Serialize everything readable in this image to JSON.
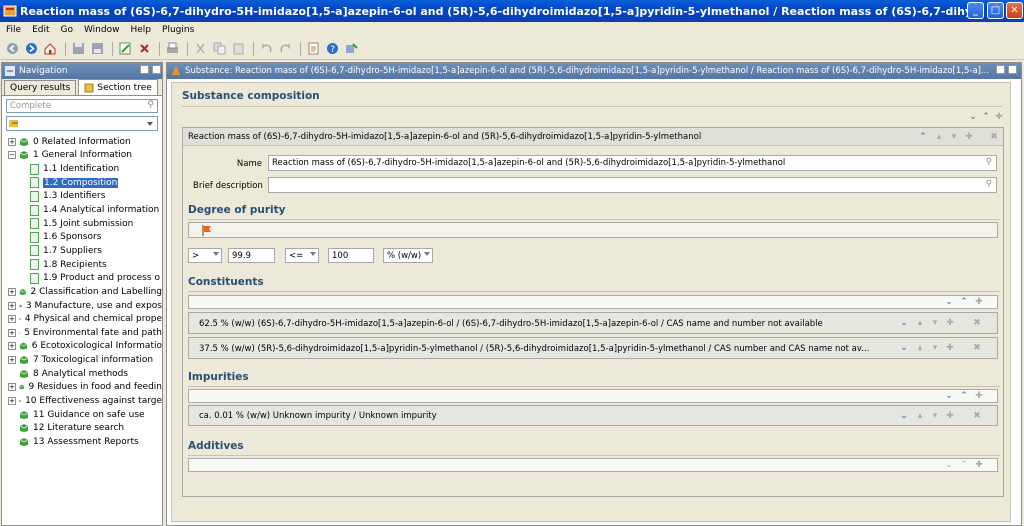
{
  "window": {
    "title": "Reaction mass of (6S)-6,7-dihydro-5H-imidazo[1,5-a]azepin-6-ol and (5R)-5,6-dihydroimidazo[1,5-a]pyridin-5-ylmethanol / Reaction mass of (6S)-6,7-dihydro-5H-imidazo[1,5-a]azepin-6-..."
  },
  "menu": [
    "File",
    "Edit",
    "Go",
    "Window",
    "Help",
    "Plugins"
  ],
  "navigation": {
    "title": "Navigation",
    "tabs": [
      "Query results",
      "Section tree"
    ],
    "search_placeholder": "Complete",
    "tree": [
      {
        "label": "0 Related Information",
        "level": 0,
        "expanded": false
      },
      {
        "label": "1 General Information",
        "level": 0,
        "expanded": true
      },
      {
        "label": "1.1 Identification",
        "level": 1
      },
      {
        "label": "1.2 Composition",
        "level": 1,
        "selected": true
      },
      {
        "label": "1.3 Identifiers",
        "level": 1
      },
      {
        "label": "1.4 Analytical information",
        "level": 1
      },
      {
        "label": "1.5 Joint submission",
        "level": 1
      },
      {
        "label": "1.6 Sponsors",
        "level": 1
      },
      {
        "label": "1.7 Suppliers",
        "level": 1
      },
      {
        "label": "1.8 Recipients",
        "level": 1
      },
      {
        "label": "1.9 Product and process o",
        "level": 1
      },
      {
        "label": "2 Classification and Labelling",
        "level": 0,
        "expanded": false
      },
      {
        "label": "3 Manufacture, use and expos",
        "level": 0,
        "expanded": false
      },
      {
        "label": "4 Physical and chemical prope",
        "level": 0,
        "expanded": false
      },
      {
        "label": "5 Environmental fate and path",
        "level": 0,
        "expanded": false
      },
      {
        "label": "6 Ecotoxicological Informatio",
        "level": 0,
        "expanded": false
      },
      {
        "label": "7 Toxicological information",
        "level": 0,
        "expanded": false
      },
      {
        "label": "8 Analytical methods",
        "level": 0,
        "leaf": true
      },
      {
        "label": "9 Residues in food and feedin",
        "level": 0,
        "expanded": false
      },
      {
        "label": "10 Effectiveness against targe",
        "level": 0,
        "expanded": false
      },
      {
        "label": "11 Guidance on safe use",
        "level": 0,
        "leaf": true
      },
      {
        "label": "12 Literature search",
        "level": 0,
        "leaf": true
      },
      {
        "label": "13 Assessment Reports",
        "level": 0,
        "leaf": true
      }
    ]
  },
  "main": {
    "header": "Substance: Reaction mass of (6S)-6,7-dihydro-5H-imidazo[1,5-a]azepin-6-ol and (5R)-5,6-dihydroimidazo[1,5-a]pyridin-5-ylmethanol / Reaction mass of (6S)-6,7-dihydro-5H-imidazo[1,5-a]...",
    "section_title": "Substance composition",
    "composition_title": "Reaction mass of (6S)-6,7-dihydro-5H-imidazo[1,5-a]azepin-6-ol and (5R)-5,6-dihydroimidazo[1,5-a]pyridin-5-ylmethanol",
    "name_label": "Name",
    "name_value": "Reaction mass of (6S)-6,7-dihydro-5H-imidazo[1,5-a]azepin-6-ol and (5R)-5,6-dihydroimidazo[1,5-a]pyridin-5-ylmethanol",
    "brief_label": "Brief description",
    "brief_value": "",
    "purity": {
      "title": "Degree of purity",
      "lower_qualifier": ">",
      "lower_value": "99.9",
      "upper_qualifier": "<=",
      "upper_value": "100",
      "unit": "% (w/w)"
    },
    "constituents": {
      "title": "Constituents",
      "rows": [
        "62.5 % (w/w) (6S)-6,7-dihydro-5H-imidazo[1,5-a]azepin-6-ol / (6S)-6,7-dihydro-5H-imidazo[1,5-a]azepin-6-ol / CAS name and number not available",
        "37.5 % (w/w) (5R)-5,6-dihydroimidazo[1,5-a]pyridin-5-ylmethanol / (5R)-5,6-dihydroimidazo[1,5-a]pyridin-5-ylmethanol / CAS number and CAS name not av..."
      ]
    },
    "impurities": {
      "title": "Impurities",
      "rows": [
        "ca. 0.01 % (w/w) Unknown impurity / Unknown impurity"
      ]
    },
    "additives": {
      "title": "Additives"
    }
  }
}
